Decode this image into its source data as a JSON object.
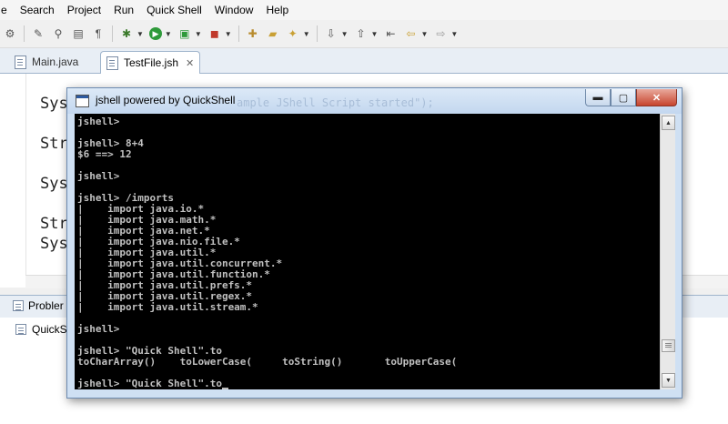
{
  "menu": [
    "e",
    "Search",
    "Project",
    "Run",
    "Quick Shell",
    "Window",
    "Help"
  ],
  "editor_tabs": [
    {
      "label": "Main.java"
    },
    {
      "label": "TestFile.jsh",
      "close": "✕"
    }
  ],
  "editor_code": [
    "Sys",
    "Str",
    "Sys",
    "Str",
    "Sys"
  ],
  "bottom_tabs": {
    "problems": "Probler",
    "quickshell": "QuickSl"
  },
  "window": {
    "title": "jshell powered by QuickShell",
    "obscured_text": "ample JShell Script started\");",
    "buttons": {
      "minimize": "▬",
      "maximize": "▢",
      "close": "✕"
    }
  },
  "console": [
    "jshell>",
    "",
    "jshell> 8+4",
    "$6 ==> 12",
    "",
    "jshell>",
    "",
    "jshell> /imports",
    "|    import java.io.*",
    "|    import java.math.*",
    "|    import java.net.*",
    "|    import java.nio.file.*",
    "|    import java.util.*",
    "|    import java.util.concurrent.*",
    "|    import java.util.function.*",
    "|    import java.util.prefs.*",
    "|    import java.util.regex.*",
    "|    import java.util.stream.*",
    "",
    "jshell>",
    "",
    "jshell> \"Quick Shell\".to",
    "toCharArray()    toLowerCase(     toString()       toUpperCase(",
    "",
    "jshell> \"Quick Shell\".to"
  ],
  "icons": {
    "scroll_up": "▲",
    "scroll_down": "▼",
    "dropdown": "▼"
  }
}
